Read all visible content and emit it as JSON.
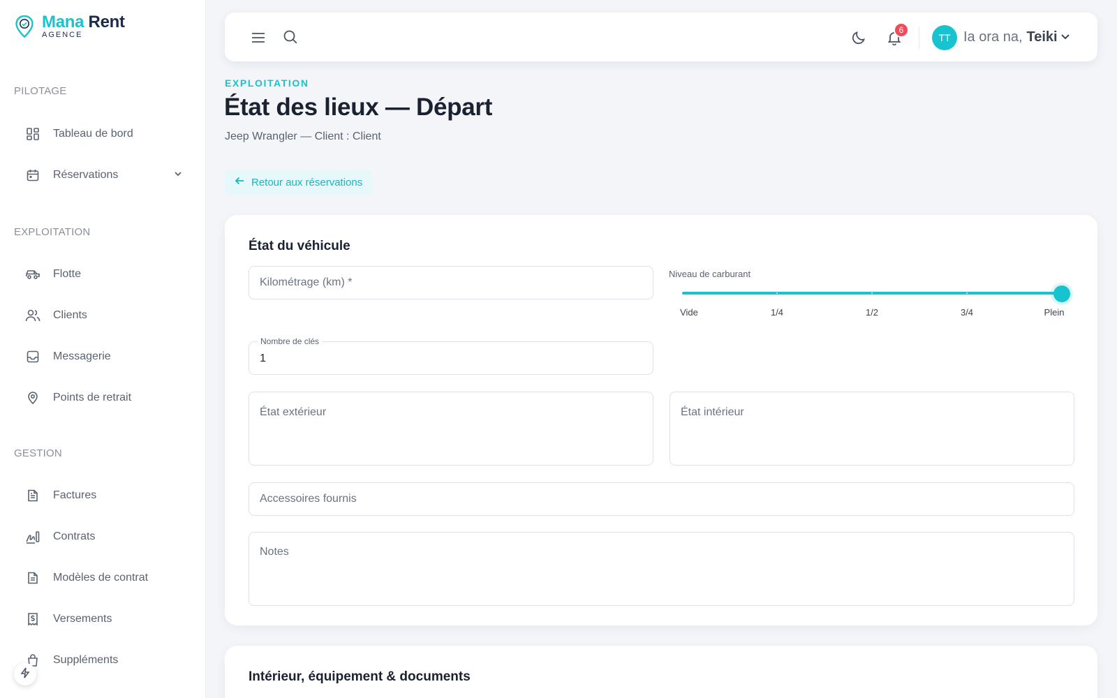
{
  "brand": {
    "name_part1": "Mana",
    "name_part2": "Rent",
    "sub": "AGENCE"
  },
  "sidebar": {
    "sections": [
      {
        "title": "PILOTAGE"
      },
      {
        "title": "EXPLOITATION"
      },
      {
        "title": "GESTION"
      }
    ],
    "items": [
      {
        "label": "Tableau de bord",
        "icon": "dashboard-icon"
      },
      {
        "label": "Réservations",
        "icon": "calendar-icon"
      },
      {
        "label": "Flotte",
        "icon": "car-icon"
      },
      {
        "label": "Clients",
        "icon": "users-icon"
      },
      {
        "label": "Messagerie",
        "icon": "inbox-icon"
      },
      {
        "label": "Points de retrait",
        "icon": "map-pin-icon"
      },
      {
        "label": "Factures",
        "icon": "invoice-icon"
      },
      {
        "label": "Contrats",
        "icon": "signature-icon"
      },
      {
        "label": "Modèles de contrat",
        "icon": "document-icon"
      },
      {
        "label": "Versements",
        "icon": "receipt-icon"
      },
      {
        "label": "Suppléments",
        "icon": "shopping-bag-icon"
      }
    ]
  },
  "header": {
    "notification_count": "6",
    "avatar_initials": "TT",
    "greeting": "Ia ora na,",
    "user_name": "Teiki"
  },
  "page": {
    "eyebrow": "EXPLOITATION",
    "title": "État des lieux — Départ",
    "subtitle": "Jeep Wrangler — Client : Client",
    "back_label": "Retour aux réservations"
  },
  "vehicle_card": {
    "title": "État du véhicule",
    "mileage_placeholder": "Kilométrage (km) *",
    "fuel_label": "Niveau de carburant",
    "fuel_marks": [
      "Vide",
      "1/4",
      "1/2",
      "3/4",
      "Plein"
    ],
    "fuel_level": 1.0,
    "keys_label": "Nombre de clés",
    "keys_value": "1",
    "exterior_placeholder": "État extérieur",
    "interior_placeholder": "État intérieur",
    "accessories_placeholder": "Accessoires fournis",
    "notes_placeholder": "Notes"
  },
  "second_card": {
    "title": "Intérieur, équipement & documents"
  },
  "colors": {
    "accent": "#17c3cf",
    "badge": "#ef4d5b"
  }
}
